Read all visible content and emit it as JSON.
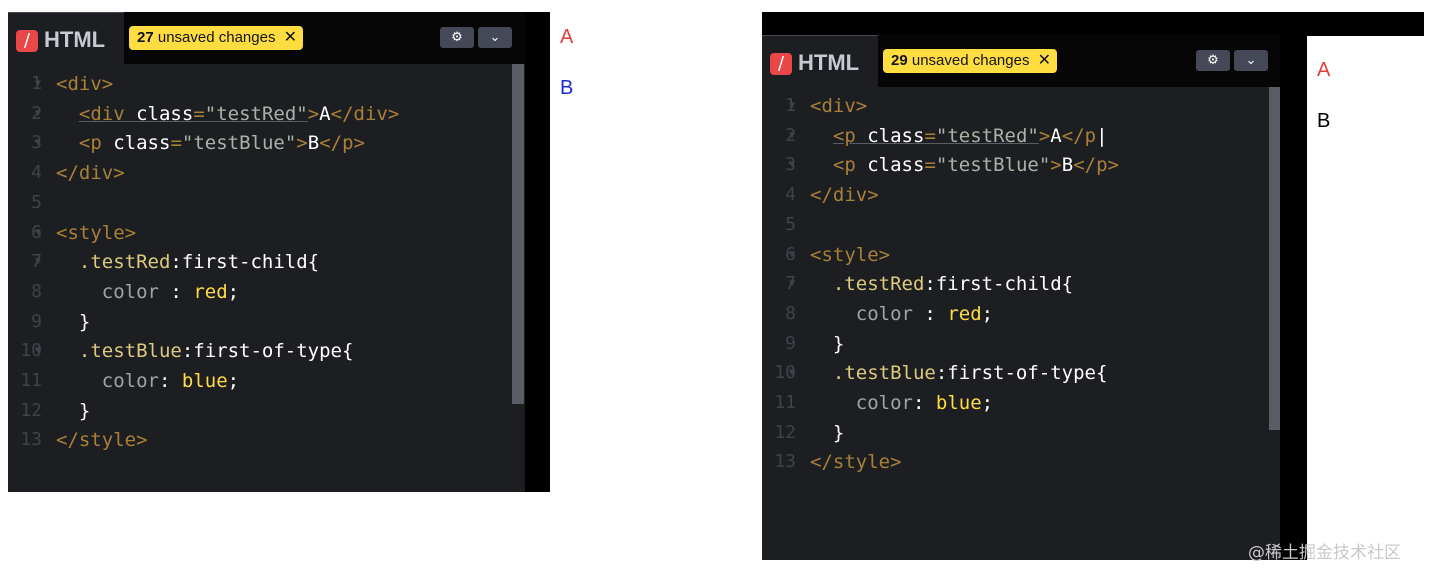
{
  "left": {
    "tab_label": "HTML",
    "unsaved_count": "27",
    "unsaved_text": "unsaved changes",
    "code_lines": [
      {
        "n": "1",
        "fold": true,
        "html": "<span class=\"t\">&lt;div&gt;</span>"
      },
      {
        "n": "2",
        "fold": true,
        "html": "  <span class=\"ul\"><span class=\"t\">&lt;div</span> <span class=\"w\">class</span><span class=\"t\">=</span><span class=\"s\">\"testRed\"</span></span><span class=\"t\">&gt;</span><span class=\"w\">A</span><span class=\"t\">&lt;/div&gt;</span>"
      },
      {
        "n": "3",
        "fold": true,
        "html": "  <span class=\"t\">&lt;p</span> <span class=\"w\">class</span><span class=\"t\">=</span><span class=\"s\">\"testBlue\"</span><span class=\"t\">&gt;</span><span class=\"w\">B</span><span class=\"t\">&lt;/p&gt;</span>"
      },
      {
        "n": "4",
        "fold": false,
        "html": "<span class=\"t\">&lt;/div&gt;</span>"
      },
      {
        "n": "5",
        "fold": false,
        "html": ""
      },
      {
        "n": "6",
        "fold": true,
        "html": "<span class=\"t\">&lt;style&gt;</span>"
      },
      {
        "n": "7",
        "fold": true,
        "html": "  <span class=\"cls\">.testRed</span><span class=\"w\">:first-child{</span>"
      },
      {
        "n": "8",
        "fold": false,
        "html": "    <span class=\"pr\">color</span> <span class=\"w\">:</span> <span class=\"v\">red</span><span class=\"w\">;</span>"
      },
      {
        "n": "9",
        "fold": false,
        "html": "  <span class=\"w\">}</span>"
      },
      {
        "n": "10",
        "fold": true,
        "html": "  <span class=\"cls\">.testBlue</span><span class=\"w\">:first-of-type{</span>"
      },
      {
        "n": "11",
        "fold": false,
        "html": "    <span class=\"pr\">color</span><span class=\"w\">:</span> <span class=\"v\">blue</span><span class=\"w\">;</span>"
      },
      {
        "n": "12",
        "fold": false,
        "html": "  <span class=\"w\">}</span>"
      },
      {
        "n": "13",
        "fold": false,
        "html": "<span class=\"t\">&lt;/style&gt;</span>"
      }
    ],
    "output": [
      {
        "text": "A",
        "color": "#e83b3b"
      },
      {
        "text": "B",
        "color": "#1c2bd1"
      }
    ]
  },
  "right": {
    "tab_label": "HTML",
    "unsaved_count": "29",
    "unsaved_text": "unsaved changes",
    "code_lines": [
      {
        "n": "1",
        "fold": true,
        "html": "<span class=\"t\">&lt;div&gt;</span>"
      },
      {
        "n": "2",
        "fold": true,
        "html": "  <span class=\"ul\"><span class=\"t\">&lt;p</span> <span class=\"w\">class</span><span class=\"t\">=</span><span class=\"s\">\"testRed\"</span></span><span class=\"t\">&gt;</span><span class=\"w\">A</span><span class=\"t\">&lt;/p</span><span class=\"w\">|</span>"
      },
      {
        "n": "3",
        "fold": true,
        "html": "  <span class=\"t\">&lt;p</span> <span class=\"w\">class</span><span class=\"t\">=</span><span class=\"s\">\"testBlue\"</span><span class=\"t\">&gt;</span><span class=\"w\">B</span><span class=\"t\">&lt;/p&gt;</span>"
      },
      {
        "n": "4",
        "fold": false,
        "html": "<span class=\"t\">&lt;/div&gt;</span>"
      },
      {
        "n": "5",
        "fold": false,
        "html": ""
      },
      {
        "n": "6",
        "fold": true,
        "html": "<span class=\"t\">&lt;style&gt;</span>"
      },
      {
        "n": "7",
        "fold": true,
        "html": "  <span class=\"cls\">.testRed</span><span class=\"w\">:first-child{</span>"
      },
      {
        "n": "8",
        "fold": false,
        "html": "    <span class=\"pr\">color</span> <span class=\"w\">:</span> <span class=\"v\">red</span><span class=\"w\">;</span>"
      },
      {
        "n": "9",
        "fold": false,
        "html": "  <span class=\"w\">}</span>"
      },
      {
        "n": "10",
        "fold": true,
        "html": "  <span class=\"cls\">.testBlue</span><span class=\"w\">:first-of-type{</span>"
      },
      {
        "n": "11",
        "fold": false,
        "html": "    <span class=\"pr\">color</span><span class=\"w\">:</span> <span class=\"v\">blue</span><span class=\"w\">;</span>"
      },
      {
        "n": "12",
        "fold": false,
        "html": "  <span class=\"w\">}</span>"
      },
      {
        "n": "13",
        "fold": false,
        "html": "<span class=\"t\">&lt;/style&gt;</span>"
      }
    ],
    "output": [
      {
        "text": "A",
        "color": "#e83b3b"
      },
      {
        "text": "B",
        "color": "#000000"
      }
    ]
  },
  "watermark": "@稀土掘金技术社区"
}
